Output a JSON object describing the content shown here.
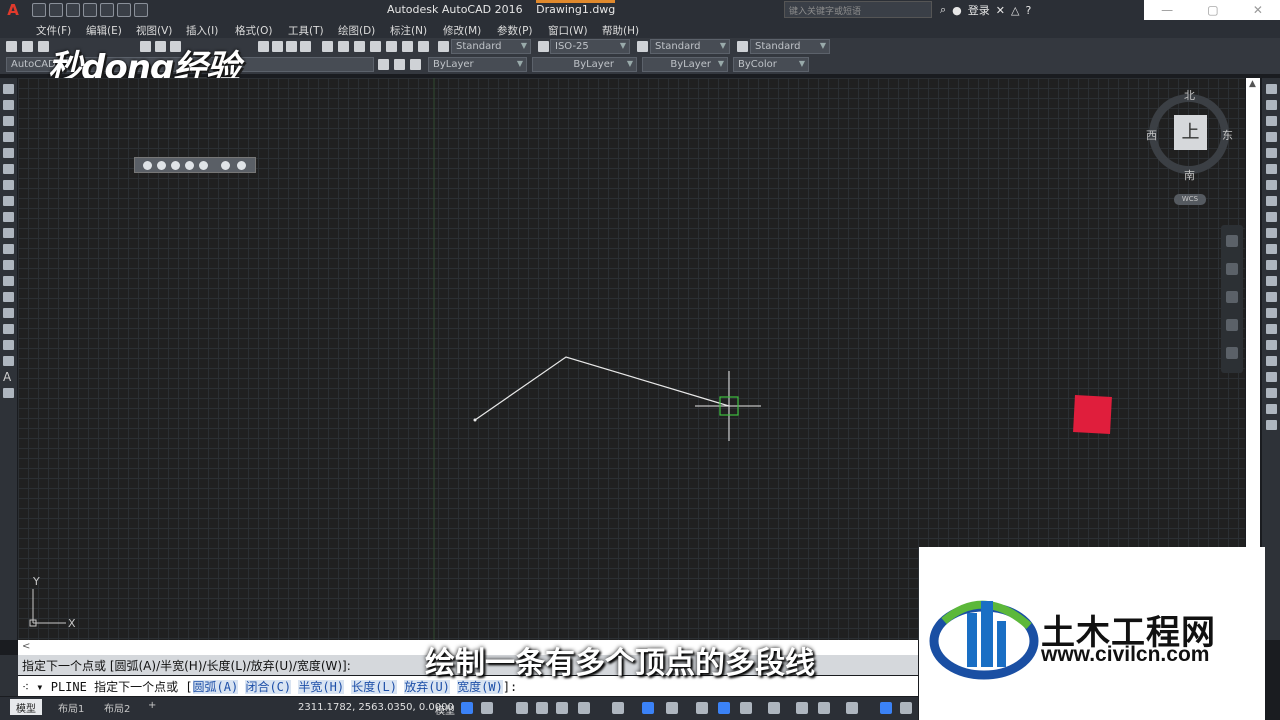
{
  "titlebar": {
    "app_title": "Autodesk AutoCAD 2016",
    "doc_name": "Drawing1.dwg",
    "search_placeholder": "键入关键字或短语",
    "login_label": "登录"
  },
  "menu": [
    {
      "label": "文件(F)"
    },
    {
      "label": "编辑(E)"
    },
    {
      "label": "视图(V)"
    },
    {
      "label": "插入(I)"
    },
    {
      "label": "格式(O)"
    },
    {
      "label": "工具(T)"
    },
    {
      "label": "绘图(D)"
    },
    {
      "label": "标注(N)"
    },
    {
      "label": "修改(M)"
    },
    {
      "label": "参数(P)"
    },
    {
      "label": "窗口(W)"
    },
    {
      "label": "帮助(H)"
    }
  ],
  "styles_toolbar": {
    "text_style": "Standard",
    "dim_style": "ISO-25",
    "table_style": "Standard",
    "mleader_style": "Standard"
  },
  "layers_toolbar": {
    "workspace": "AutoCAD",
    "color": "ByLayer",
    "linetype": "ByLayer",
    "lineweight": "ByLayer",
    "plotstyle": "ByColor"
  },
  "watermark": "秒dong经验",
  "viewcube": {
    "top_face": "上",
    "north": "北",
    "south": "南",
    "east": "东",
    "west": "西",
    "wcs": "WCS"
  },
  "ucs": {
    "x_label": "X",
    "y_label": "Y"
  },
  "command": {
    "history": "指定下一个点或 [圆弧(A)/半宽(H)/长度(L)/放弃(U)/宽度(W)]:",
    "prefix": "PLINE 指定下一个点或 [",
    "options": [
      "圆弧(A)",
      "闭合(C)",
      "半宽(H)",
      "长度(L)",
      "放弃(U)",
      "宽度(W)"
    ],
    "suffix": "]:"
  },
  "subtitle": "绘制一条有多个顶点的多段线",
  "status": {
    "tabs": [
      "模型",
      "布局1",
      "布局2"
    ],
    "coords": "2311.1782, 2563.0350, 0.0000",
    "mode": "模型"
  },
  "site_logo": {
    "name": "土木工程网",
    "url": "www.civilcn.com"
  }
}
